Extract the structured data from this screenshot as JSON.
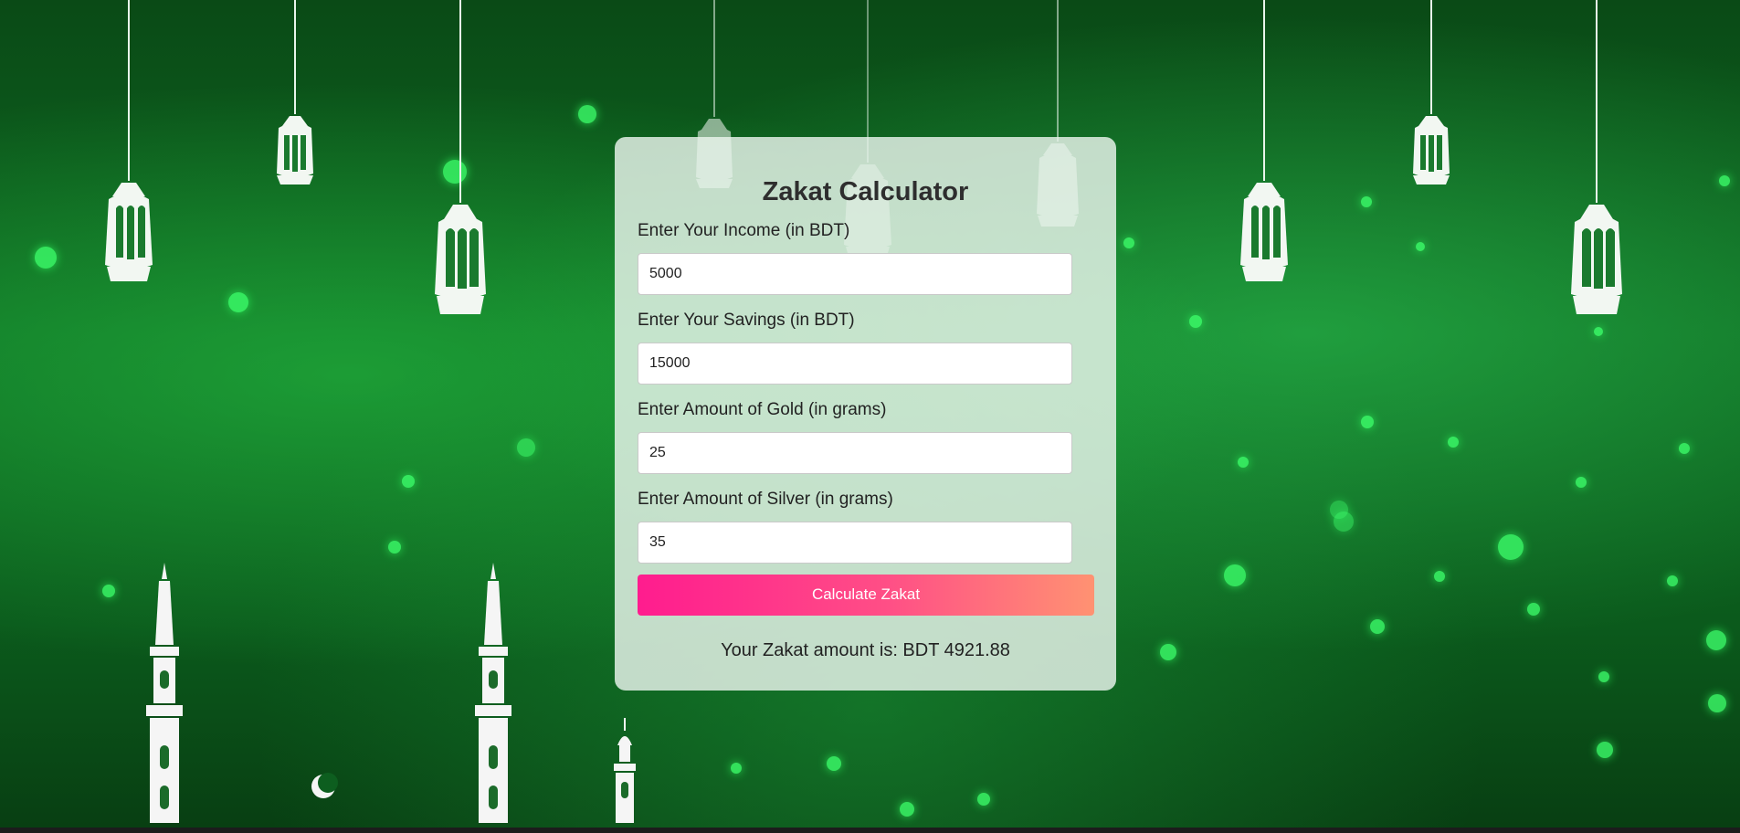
{
  "calculator": {
    "title": "Zakat Calculator",
    "fields": [
      {
        "label": "Enter Your Income (in BDT)",
        "value": "5000"
      },
      {
        "label": "Enter Your Savings (in BDT)",
        "value": "15000"
      },
      {
        "label": "Enter Amount of Gold (in grams)",
        "value": "25"
      },
      {
        "label": "Enter Amount of Silver (in grams)",
        "value": "35"
      }
    ],
    "button_label": "Calculate Zakat",
    "result_text": "Your Zakat amount is: BDT 4921.88"
  },
  "theme": {
    "background": "#0e6a22",
    "card": "#ebf5ee",
    "button_gradient_start": "#ff1c8e",
    "button_gradient_end": "#ff9272"
  },
  "decorations": {
    "lantern_icon": "hanging-lantern-icon",
    "minaret_icon": "minaret-icon",
    "crescent_icon": "crescent-moon-icon"
  }
}
